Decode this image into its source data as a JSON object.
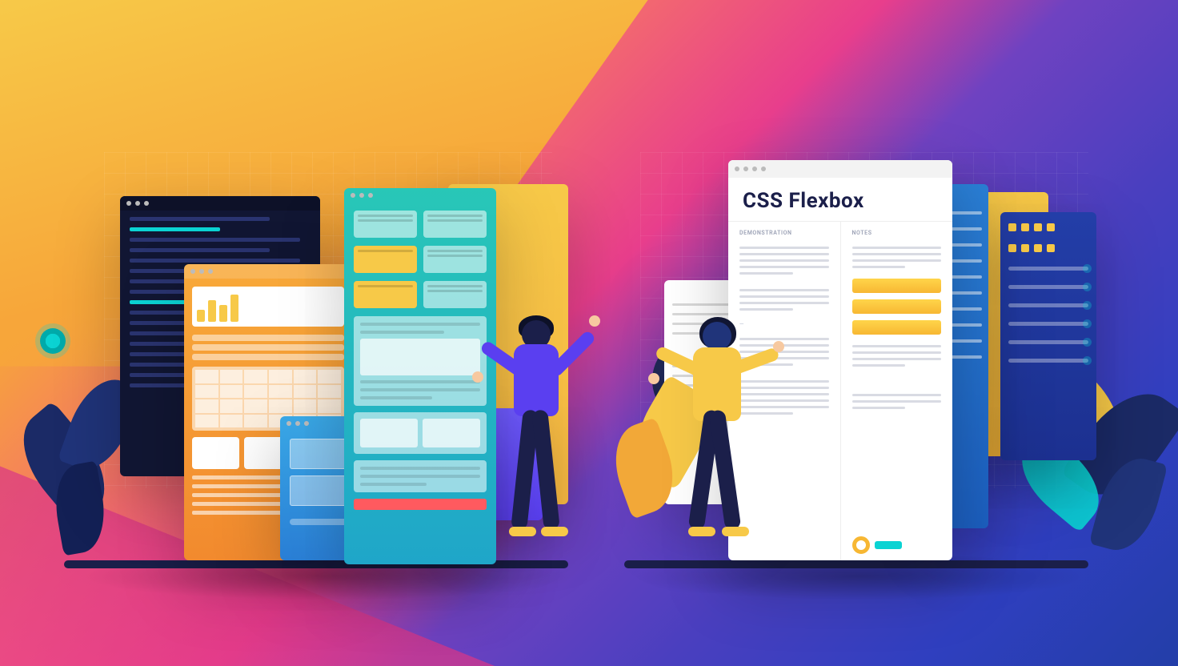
{
  "main_title": "CSS Flexbox",
  "doc": {
    "left_column_heading": "Demonstration",
    "right_column_heading": "Notes"
  },
  "colors": {
    "yellow": "#f7c948",
    "orange": "#f28a2e",
    "teal": "#28c7b7",
    "cyan": "#0bd3d3",
    "blue": "#2a7fd6",
    "indigo": "#233ea8",
    "violet": "#5a3ff0",
    "navy": "#1b1f4a",
    "pink": "#e83e8c",
    "red_accent": "#ff5a5f"
  }
}
